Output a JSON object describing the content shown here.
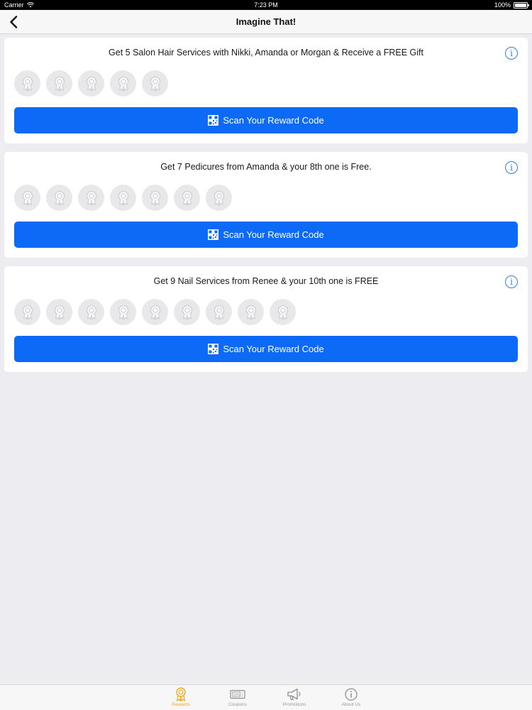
{
  "status_bar": {
    "carrier": "Carrier",
    "time": "7:23 PM",
    "battery": "100%"
  },
  "nav": {
    "title": "Imagine That!",
    "back_icon": "chevron-left-icon"
  },
  "rewards": [
    {
      "title": "Get 5 Salon Hair Services with Nikki, Amanda or Morgan & Receive a FREE Gift",
      "stamp_count": 5,
      "button_label": "Scan Your Reward Code"
    },
    {
      "title": "Get 7 Pedicures from Amanda & your 8th one is Free.",
      "stamp_count": 7,
      "button_label": "Scan Your Reward Code"
    },
    {
      "title": "Get 9 Nail Services from Renee & your 10th one is FREE",
      "stamp_count": 9,
      "button_label": "Scan Your Reward Code"
    }
  ],
  "tabs": [
    {
      "label": "Rewards",
      "icon": "ribbon-icon",
      "active": true
    },
    {
      "label": "Coupons",
      "icon": "coupon-icon",
      "active": false
    },
    {
      "label": "Promotions",
      "icon": "megaphone-icon",
      "active": false
    },
    {
      "label": "About Us",
      "icon": "info-icon",
      "active": false
    }
  ],
  "colors": {
    "accent_blue": "#0d6af7",
    "active_tab": "#f5a623",
    "background": "#ececf1"
  }
}
